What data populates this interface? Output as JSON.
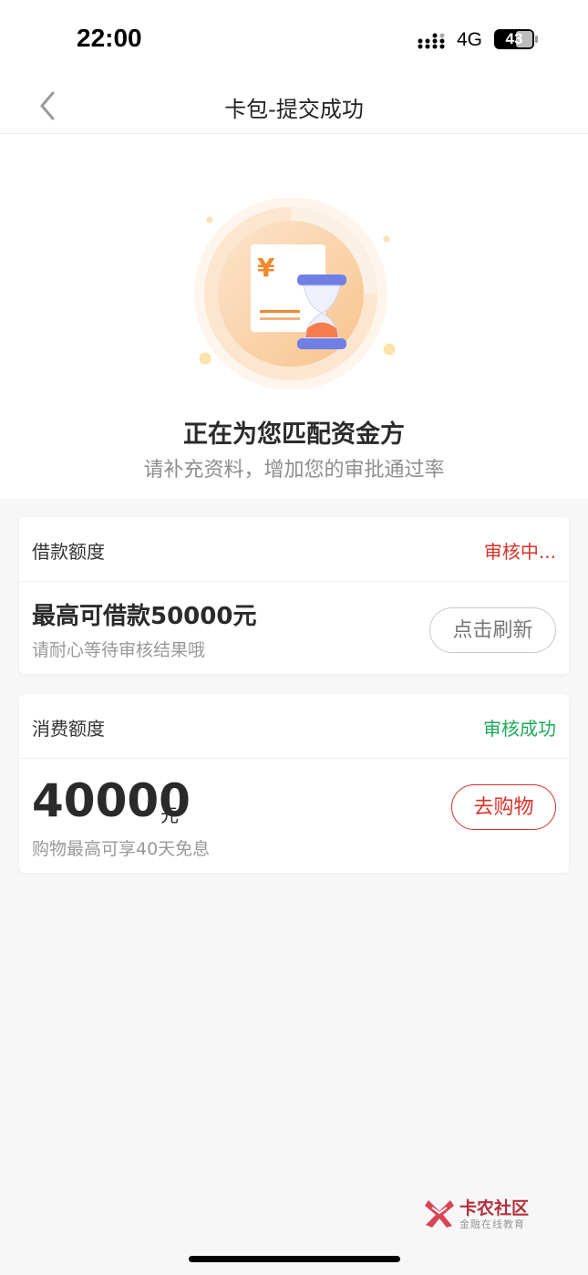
{
  "status_bar": {
    "time": "22:00",
    "network": "4G",
    "battery": "43"
  },
  "nav": {
    "title": "卡包-提交成功",
    "back_icon": "chevron-left-icon"
  },
  "hero": {
    "title": "正在为您匹配资金方",
    "subtitle": "请补充资料，增加您的审批通过率",
    "illustration_symbol": "¥"
  },
  "loan_card": {
    "label": "借款额度",
    "status": "审核中...",
    "headline": "最高可借款50000元",
    "hint": "请耐心等待审核结果哦",
    "button": "点击刷新"
  },
  "consume_card": {
    "label": "消费额度",
    "status": "审核成功",
    "amount": "40000",
    "unit": "元",
    "hint": "购物最高可享40天免息",
    "button": "去购物"
  },
  "watermark": {
    "name": "卡农社区",
    "slogan": "金融在线教育"
  },
  "colors": {
    "pending": "#d8322a",
    "success": "#1faa5b",
    "accent": "#f08a2c"
  }
}
